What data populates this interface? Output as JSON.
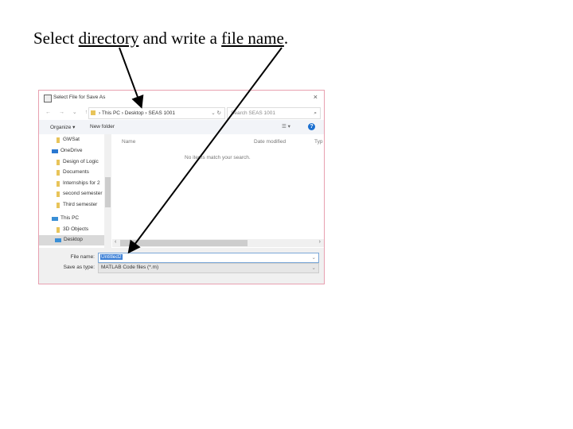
{
  "slide": {
    "title_pre": "Select ",
    "title_link1": "directory",
    "title_mid": " and write a ",
    "title_link2": "file name",
    "title_post": "."
  },
  "dialog": {
    "title": "Select File for Save As",
    "close": "×",
    "nav_buttons": "← → ⌄ ↑",
    "breadcrumb": "›  This PC  ›  Desktop  ›  SEAS 1001",
    "refresh": "⌄ ↻",
    "search_placeholder": "Search SEAS 1001",
    "search_icon": "⌕",
    "organize": "Organize ▾",
    "new_folder": "New folder",
    "view": "☰ ▾",
    "help": "?",
    "nav_items": [
      {
        "label": "GWSat",
        "type": "folder"
      },
      {
        "label": "OneDrive",
        "type": "cloud"
      },
      {
        "label": "Design of Logic",
        "type": "folder"
      },
      {
        "label": "Documents",
        "type": "folder"
      },
      {
        "label": "Internships for 2",
        "type": "folder"
      },
      {
        "label": "second semester",
        "type": "folder"
      },
      {
        "label": "Third semester",
        "type": "folder"
      },
      {
        "label": "This PC",
        "type": "pc"
      },
      {
        "label": "3D Objects",
        "type": "folder"
      },
      {
        "label": "Desktop",
        "type": "desktop"
      }
    ],
    "columns": [
      "Name",
      "Date modified",
      "Typ"
    ],
    "empty_message": "No items match your search.",
    "file_name_label": "File name:",
    "file_name_value": "Untitled2",
    "save_type_label": "Save as type:",
    "save_type_value": "MATLAB Code files (*.m)",
    "dropdown": "⌄"
  }
}
